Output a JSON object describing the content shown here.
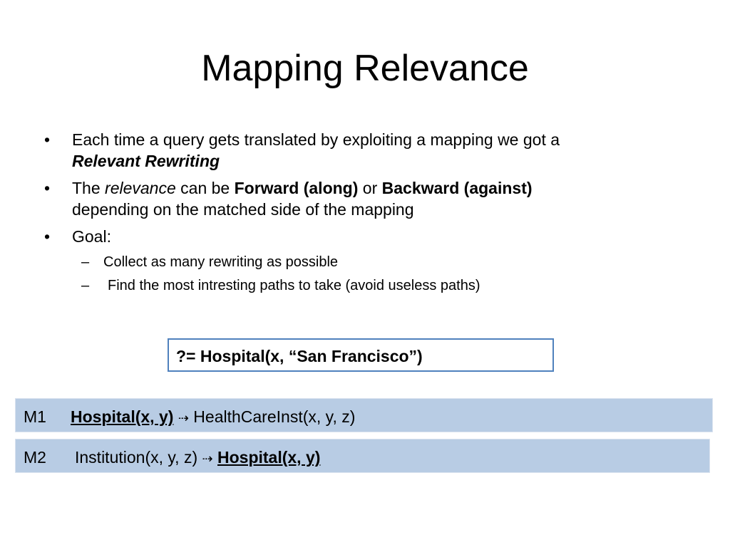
{
  "slide": {
    "title": "Mapping Relevance",
    "bullets": {
      "b1_text": "Each time a query gets translated by exploiting a mapping we got a",
      "b1_emph": "Relevant Rewriting",
      "b2_pre": "The",
      "b2_relevance": "relevance",
      "b2_mid": "can be",
      "b2_forward": "Forward (along)",
      "b2_or": "or",
      "b2_backward": "Backward (against)",
      "b2_rest": "depending on the matched side of the mapping",
      "b3_text": "Goal:",
      "sub1": "Collect as many rewriting as possible",
      "sub2": "Find the most intresting paths to take (avoid useless paths)"
    },
    "bullet_char": "•",
    "dash_char": "–",
    "query": "?= Hospital(x, “San Francisco”)",
    "mappings": {
      "m1_id": "M1",
      "m1_lhs": "Hospital(x, y)",
      "m1_arrow": "⇢",
      "m1_rhs": "HealthCareInst(x, y, z)",
      "m2_id": "M2",
      "m2_lhs": "Institution(x, y, z)",
      "m2_arrow": "⇢",
      "m2_rhs": "Hospital(x, y)"
    },
    "colors": {
      "mapping_bg": "#b8cce4",
      "query_border": "#4f81bd"
    }
  }
}
